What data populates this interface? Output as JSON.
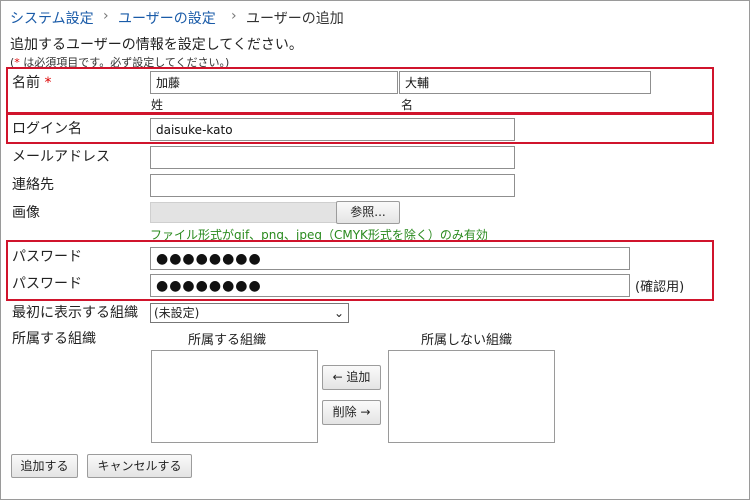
{
  "breadcrumb": {
    "items": [
      "システム設定",
      "ユーザーの設定"
    ],
    "separator": "›",
    "current": "ユーザーの追加"
  },
  "intro": "追加するユーザーの情報を設定してください。",
  "note": {
    "star": "*",
    "text": " は必須項目です。必ず設定してください。)",
    "open": "("
  },
  "fields": {
    "name": {
      "label": "名前",
      "required_mark": "*",
      "last_value": "加藤",
      "first_value": "大輔",
      "last_sub": "姓",
      "first_sub": "名"
    },
    "login": {
      "label": "ログイン名",
      "value": "daisuke-kato"
    },
    "email": {
      "label": "メールアドレス",
      "value": ""
    },
    "contact": {
      "label": "連絡先",
      "value": ""
    },
    "image": {
      "label": "画像",
      "browse_label": "参照...",
      "hint": "ファイル形式がgif、png、jpeg（CMYK形式を除く）のみ有効"
    },
    "password": {
      "label": "パスワード",
      "value": "●●●●●●●●"
    },
    "password_confirm": {
      "label": "パスワード",
      "value": "●●●●●●●●",
      "suffix": "(確認用)"
    },
    "first_org": {
      "label": "最初に表示する組織",
      "selected": "(未設定)"
    },
    "orgs": {
      "label": "所属する組織",
      "member_header": "所属する組織",
      "nonmember_header": "所属しない組織",
      "add_label": "← 追加",
      "remove_label": "削除 →"
    }
  },
  "actions": {
    "submit_label": "追加する",
    "cancel_label": "キャンセルする"
  },
  "colors": {
    "highlight_border": "#d0142c",
    "link": "#1a5ba8",
    "hint": "#2a8a1e"
  }
}
